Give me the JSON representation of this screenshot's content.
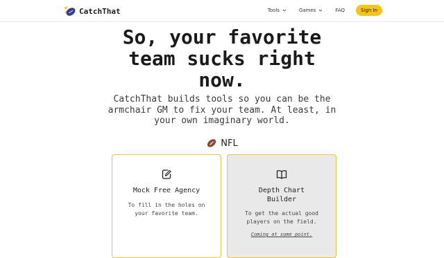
{
  "brand": {
    "name": "CatchThat",
    "logo": "football-logo-icon"
  },
  "nav": {
    "items": [
      {
        "label": "Tools",
        "has_dropdown": true
      },
      {
        "label": "Games",
        "has_dropdown": true
      },
      {
        "label": "FAQ",
        "has_dropdown": false
      }
    ],
    "signin_label": "Sign In"
  },
  "hero": {
    "title_lines": [
      "So, your favorite",
      "team sucks right",
      "now."
    ],
    "subtitle_lines": [
      "CatchThat builds tools so you can be the",
      "armchair GM to fix your team. At least, in",
      "your own imaginary world."
    ]
  },
  "section": {
    "label": "NFL",
    "icon": "football-icon"
  },
  "cards": [
    {
      "icon": "edit-icon",
      "title_lines": [
        "Mock Free Agency"
      ],
      "desc_lines": [
        "To fill in the holes on",
        "your favorite team."
      ],
      "note": ""
    },
    {
      "icon": "book-icon",
      "title_lines": [
        "Depth Chart",
        "Builder"
      ],
      "desc_lines": [
        "To get the actual good",
        "players on the field."
      ],
      "note": "Coming at some point."
    }
  ],
  "colors": {
    "accent": "#f5c518",
    "card_border": "#f2c233",
    "disabled_card_bg": "#e9e9e9"
  }
}
